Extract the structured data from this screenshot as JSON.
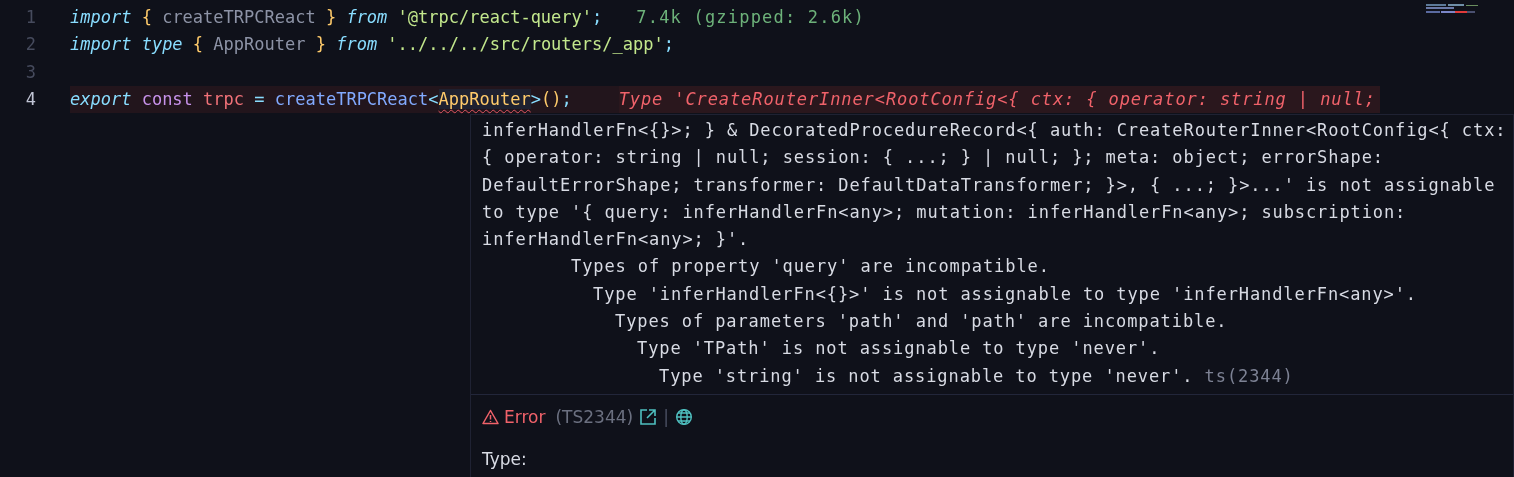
{
  "editor": {
    "lines": [
      {
        "number": "1",
        "current": false,
        "error": false,
        "tokens": [
          {
            "text": "import ",
            "kind": "keyword"
          },
          {
            "text": "{",
            "kind": "brace"
          },
          {
            "text": " createTRPCReact ",
            "kind": "unused"
          },
          {
            "text": "} ",
            "kind": "brace"
          },
          {
            "text": "from ",
            "kind": "keyword"
          },
          {
            "text": "'@trpc/react-query'",
            "kind": "string"
          },
          {
            "text": ";",
            "kind": "operator"
          }
        ],
        "hint": "7.4k (gzipped: 2.6k)"
      },
      {
        "number": "2",
        "current": false,
        "error": false,
        "tokens": [
          {
            "text": "import ",
            "kind": "keyword"
          },
          {
            "text": "type ",
            "kind": "keyword"
          },
          {
            "text": "{",
            "kind": "brace"
          },
          {
            "text": " AppRouter ",
            "kind": "unused"
          },
          {
            "text": "} ",
            "kind": "brace"
          },
          {
            "text": "from ",
            "kind": "keyword"
          },
          {
            "text": "'../../../src/routers/_app'",
            "kind": "string"
          },
          {
            "text": ";",
            "kind": "operator"
          }
        ]
      },
      {
        "number": "3",
        "current": false,
        "error": false
      },
      {
        "number": "4",
        "current": true,
        "error": true,
        "tokens": [
          {
            "text": "export ",
            "kind": "keyword"
          },
          {
            "text": "const ",
            "kind": "storage"
          },
          {
            "text": "trpc ",
            "kind": "variable"
          },
          {
            "text": "= ",
            "kind": "operator"
          },
          {
            "text": "createTRPCReact",
            "kind": "function"
          },
          {
            "text": "<",
            "kind": "operator"
          },
          {
            "text": "AppRouter",
            "kind": "squiggle"
          },
          {
            "text": ">",
            "kind": "operator"
          },
          {
            "text": "()",
            "kind": "brace"
          },
          {
            "text": ";",
            "kind": "operator"
          }
        ],
        "diagnostic": "Type 'CreateRouterInner<RootConfig<{ ctx: { operator: string | null;"
      }
    ]
  },
  "hover": {
    "message_lines": [
      "inferHandlerFn<{}>; } & DecoratedProcedureRecord<{ auth: CreateRouterInner<RootConfig<{ ctx:",
      "{ operator: string | null; session: { ...; } | null; }; meta: object; errorShape:",
      "DefaultErrorShape; transformer: DefaultDataTransformer; }>, { ...; }>...' is not assignable",
      "to type '{ query: inferHandlerFn<any>; mutation: inferHandlerFn<any>; subscription:",
      "inferHandlerFn<any>; }'."
    ],
    "children": [
      {
        "text": "Types of property 'query' are incompatible.",
        "children": [
          {
            "text": "Type 'inferHandlerFn<{}>' is not assignable to type 'inferHandlerFn<any>'.",
            "children": [
              {
                "text": "Types of parameters 'path' and 'path' are incompatible.",
                "children": [
                  {
                    "text": "Type 'TPath' is not assignable to type 'never'.",
                    "children": [
                      {
                        "text": "Type 'string' is not assignable to type 'never'.",
                        "source": "ts(2344)"
                      }
                    ]
                  }
                ]
              }
            ]
          }
        ]
      }
    ],
    "severity": "Error",
    "code": "(TS2344)",
    "separator": "|",
    "type_label": "Type:"
  }
}
